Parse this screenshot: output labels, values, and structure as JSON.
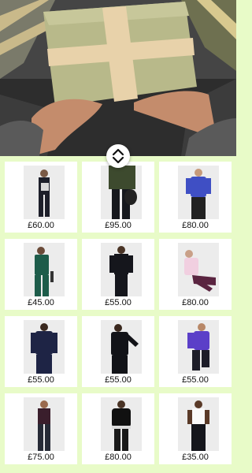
{
  "colors": {
    "background": "#e8fbc8",
    "card": "#ffffff",
    "price_text": "#111111"
  },
  "hero": {
    "image": "gift-box-in-hands",
    "scroll_icon": "up-down-chevron-icon"
  },
  "products": [
    {
      "price": "£60.00",
      "image": "person-dark-outfit-patterned-top"
    },
    {
      "price": "£95.00",
      "image": "dark-green-jacket-leggings-bag"
    },
    {
      "price": "£80.00",
      "image": "blue-half-zip-top"
    },
    {
      "price": "£45.00",
      "image": "green-jumpsuit"
    },
    {
      "price": "£55.00",
      "image": "black-long-sleeve-top"
    },
    {
      "price": "£80.00",
      "image": "pink-hoodie-burgundy-leggings"
    },
    {
      "price": "£55.00",
      "image": "navy-long-sleeve-top"
    },
    {
      "price": "£55.00",
      "image": "black-long-sleeve-top"
    },
    {
      "price": "£55.00",
      "image": "purple-long-sleeve-top"
    },
    {
      "price": "£75.00",
      "image": "dark-tank-top-leggings"
    },
    {
      "price": "£80.00",
      "image": "black-puffer-jacket"
    },
    {
      "price": "£35.00",
      "image": "white-tank-top"
    }
  ]
}
